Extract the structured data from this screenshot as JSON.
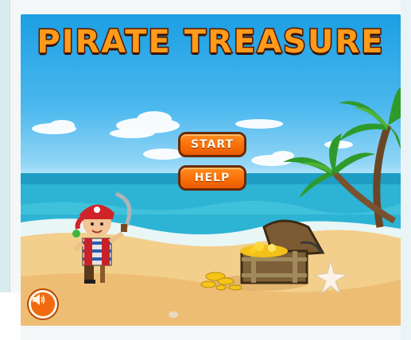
{
  "game": {
    "title": "PIRATE TREASURE",
    "start_label": "START",
    "help_label": "HELP",
    "sound_icon": "speaker-icon"
  },
  "colors": {
    "sky": "#1b9fe3",
    "sea": "#2fb8d6",
    "sand": "#f3cf8c",
    "button": "#f96d09",
    "title": "#ff9a1a"
  }
}
